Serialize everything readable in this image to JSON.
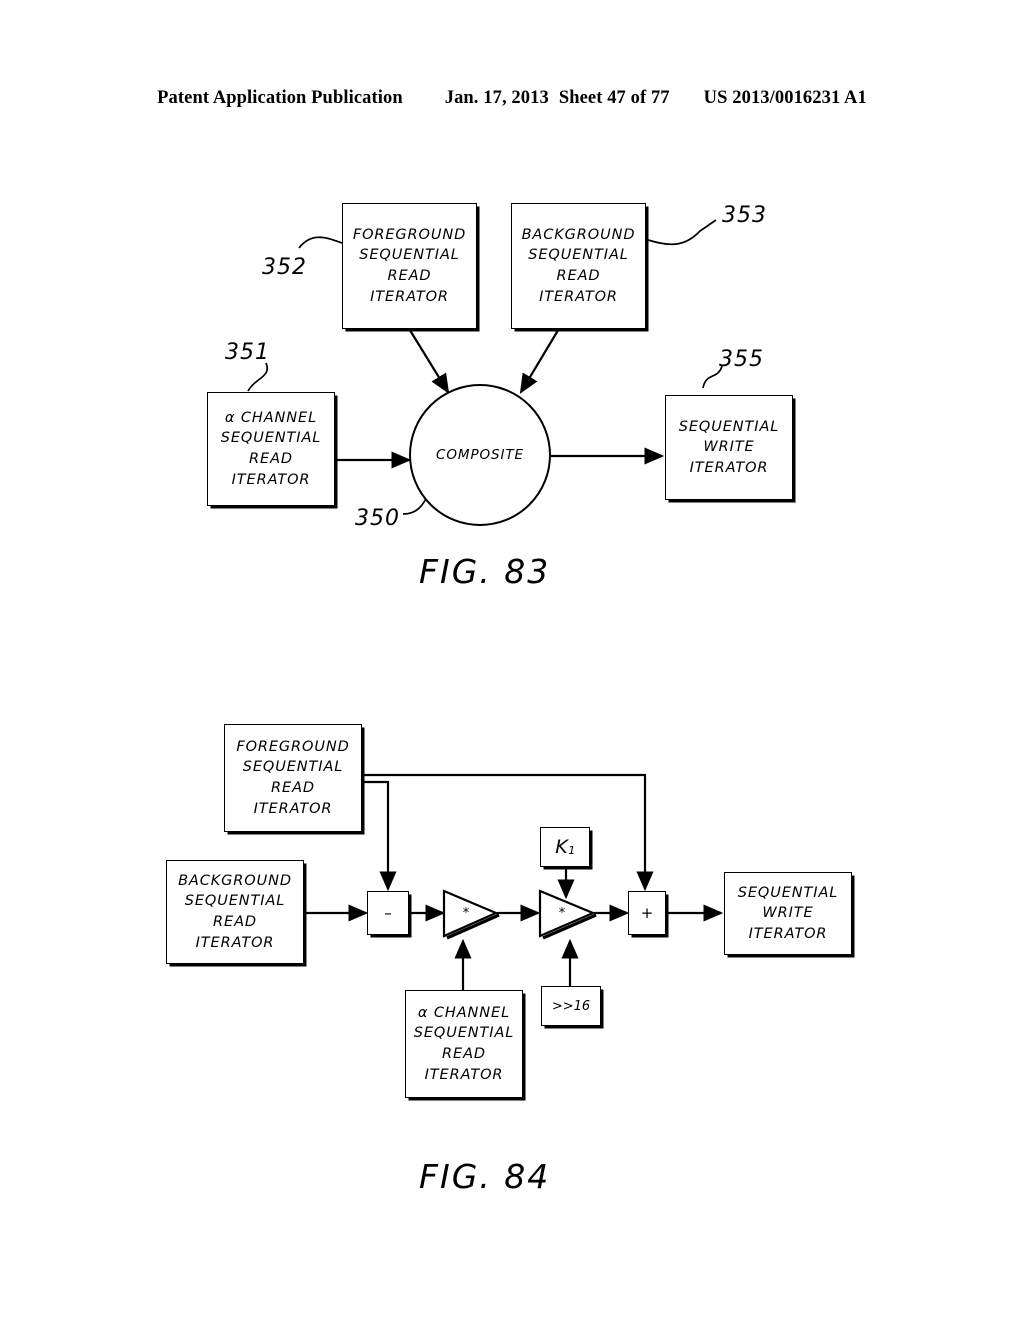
{
  "header": {
    "publication": "Patent Application Publication",
    "date": "Jan. 17, 2013",
    "sheet": "Sheet 47 of 77",
    "patent_number": "US 2013/0016231 A1"
  },
  "figure_83": {
    "caption": "FIG. 83",
    "boxes": {
      "foreground": {
        "l1": "FOREGROUND",
        "l2": "SEQUENTIAL",
        "l3": "READ",
        "l4": "ITERATOR"
      },
      "background": {
        "l1": "BACKGROUND",
        "l2": "SEQUENTIAL",
        "l3": "READ",
        "l4": "ITERATOR"
      },
      "alpha": {
        "l1": "α CHANNEL",
        "l2": "SEQUENTIAL",
        "l3": "READ",
        "l4": "ITERATOR"
      },
      "write": {
        "l1": "SEQUENTIAL",
        "l2": "WRITE",
        "l3": "ITERATOR"
      },
      "composite": {
        "label": "COMPOSITE"
      }
    },
    "refs": {
      "alpha": "351",
      "foreground": "352",
      "background": "353",
      "composite": "350",
      "write": "355"
    }
  },
  "figure_84": {
    "caption": "FIG. 84",
    "boxes": {
      "foreground": {
        "l1": "FOREGROUND",
        "l2": "SEQUENTIAL",
        "l3": "READ",
        "l4": "ITERATOR"
      },
      "background": {
        "l1": "BACKGROUND",
        "l2": "SEQUENTIAL",
        "l3": "READ",
        "l4": "ITERATOR"
      },
      "alpha": {
        "l1": "α CHANNEL",
        "l2": "SEQUENTIAL",
        "l3": "READ",
        "l4": "ITERATOR"
      },
      "write": {
        "l1": "SEQUENTIAL",
        "l2": "WRITE",
        "l3": "ITERATOR"
      }
    },
    "operators": {
      "subtract": "–",
      "multiply_1": "*",
      "multiply_2": "*",
      "add": "+",
      "constant_k": "K",
      "constant_k_sub": "1",
      "shift": ">>16"
    }
  }
}
